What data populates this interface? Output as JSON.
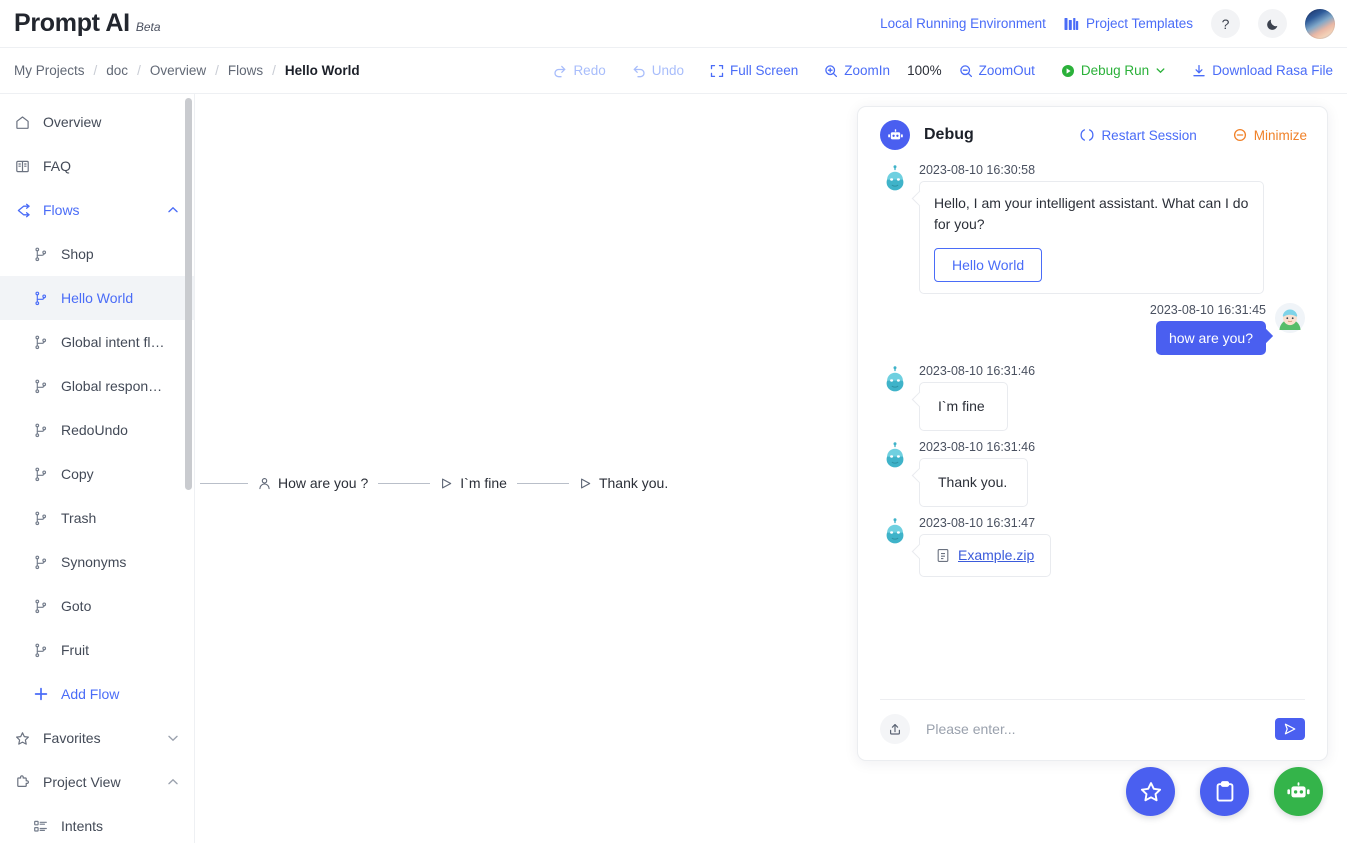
{
  "topbar": {
    "brand_name": "Prompt AI",
    "brand_beta": "Beta",
    "env_link": "Local Running Environment",
    "templates_link": "Project Templates",
    "help_glyph": "?",
    "theme_icon": "moon-icon",
    "avatar_icon": "user-avatar"
  },
  "toolbar": {
    "breadcrumbs": [
      {
        "label": "My Projects",
        "active": false
      },
      {
        "label": "doc",
        "active": false
      },
      {
        "label": "Overview",
        "active": false
      },
      {
        "label": "Flows",
        "active": false
      },
      {
        "label": "Hello World",
        "active": true
      }
    ],
    "separator": "/",
    "redo": "Redo",
    "undo": "Undo",
    "full_screen": "Full Screen",
    "zoom_in": "ZoomIn",
    "zoom_level": "100%",
    "zoom_out": "ZoomOut",
    "debug_run": "Debug Run",
    "download": "Download Rasa File",
    "accent": "#4a6cf7",
    "debug_run_color": "#2bb13a"
  },
  "sidebar": {
    "items": [
      {
        "label": "Overview",
        "icon": "home-icon",
        "level": 0,
        "state": "normal",
        "chevron": ""
      },
      {
        "label": "FAQ",
        "icon": "book-icon",
        "level": 0,
        "state": "normal",
        "chevron": ""
      },
      {
        "label": "Flows",
        "icon": "flow-icon",
        "level": 0,
        "state": "blue",
        "chevron": "up"
      },
      {
        "label": "Shop",
        "icon": "branch-icon",
        "level": 1,
        "state": "normal",
        "chevron": ""
      },
      {
        "label": "Hello World",
        "icon": "branch-icon",
        "level": 1,
        "state": "selected",
        "chevron": ""
      },
      {
        "label": "Global intent fl…",
        "icon": "branch-icon",
        "level": 1,
        "state": "normal",
        "chevron": ""
      },
      {
        "label": "Global respon…",
        "icon": "branch-icon",
        "level": 1,
        "state": "normal",
        "chevron": ""
      },
      {
        "label": "RedoUndo",
        "icon": "branch-icon",
        "level": 1,
        "state": "normal",
        "chevron": ""
      },
      {
        "label": "Copy",
        "icon": "branch-icon",
        "level": 1,
        "state": "normal",
        "chevron": ""
      },
      {
        "label": "Trash",
        "icon": "branch-icon",
        "level": 1,
        "state": "normal",
        "chevron": ""
      },
      {
        "label": "Synonyms",
        "icon": "branch-icon",
        "level": 1,
        "state": "normal",
        "chevron": ""
      },
      {
        "label": "Goto",
        "icon": "branch-icon",
        "level": 1,
        "state": "normal",
        "chevron": ""
      },
      {
        "label": "Fruit",
        "icon": "branch-icon",
        "level": 1,
        "state": "normal",
        "chevron": ""
      },
      {
        "label": "Add Flow",
        "icon": "plus-icon",
        "level": 1,
        "state": "addflow",
        "chevron": ""
      },
      {
        "label": "Favorites",
        "icon": "star-icon",
        "level": 0,
        "state": "normal",
        "chevron": "down"
      },
      {
        "label": "Project View",
        "icon": "puzzle-icon",
        "level": 0,
        "state": "normal",
        "chevron": "up"
      },
      {
        "label": "Intents",
        "icon": "list-icon",
        "level": 1,
        "state": "normal",
        "chevron": ""
      }
    ]
  },
  "canvas": {
    "nodes": [
      {
        "label": "How are you ?",
        "icon": "user-node-icon"
      },
      {
        "label": "I`m fine",
        "icon": "reply-node-icon"
      },
      {
        "label": "Thank you.",
        "icon": "reply-node-icon"
      }
    ]
  },
  "debug": {
    "title": "Debug",
    "bot_icon": "robot-icon",
    "restart": "Restart Session",
    "minimize": "Minimize",
    "messages": [
      {
        "side": "bot",
        "time": "2023-08-10 16:30:58",
        "text": "Hello, I am your intelligent assistant. What can I do for you?",
        "button": "Hello World",
        "kind": "text"
      },
      {
        "side": "user",
        "time": "2023-08-10 16:31:45",
        "text": "how are you?",
        "kind": "text"
      },
      {
        "side": "bot",
        "time": "2023-08-10 16:31:46",
        "text": "I`m fine",
        "kind": "text"
      },
      {
        "side": "bot",
        "time": "2023-08-10 16:31:46",
        "text": "Thank you.",
        "kind": "text"
      },
      {
        "side": "bot",
        "time": "2023-08-10 16:31:47",
        "text": "Example.zip",
        "kind": "file"
      }
    ],
    "input_placeholder": "Please enter...",
    "upload_icon": "upload-icon",
    "send_icon": "send-icon"
  },
  "fabs": [
    {
      "icon": "star-icon",
      "color": "#4a5ff0",
      "name": "favorites-fab"
    },
    {
      "icon": "clipboard-icon",
      "color": "#4a5ff0",
      "name": "clipboard-fab"
    },
    {
      "icon": "robot-icon",
      "color": "#34b44a",
      "name": "robot-fab"
    }
  ]
}
